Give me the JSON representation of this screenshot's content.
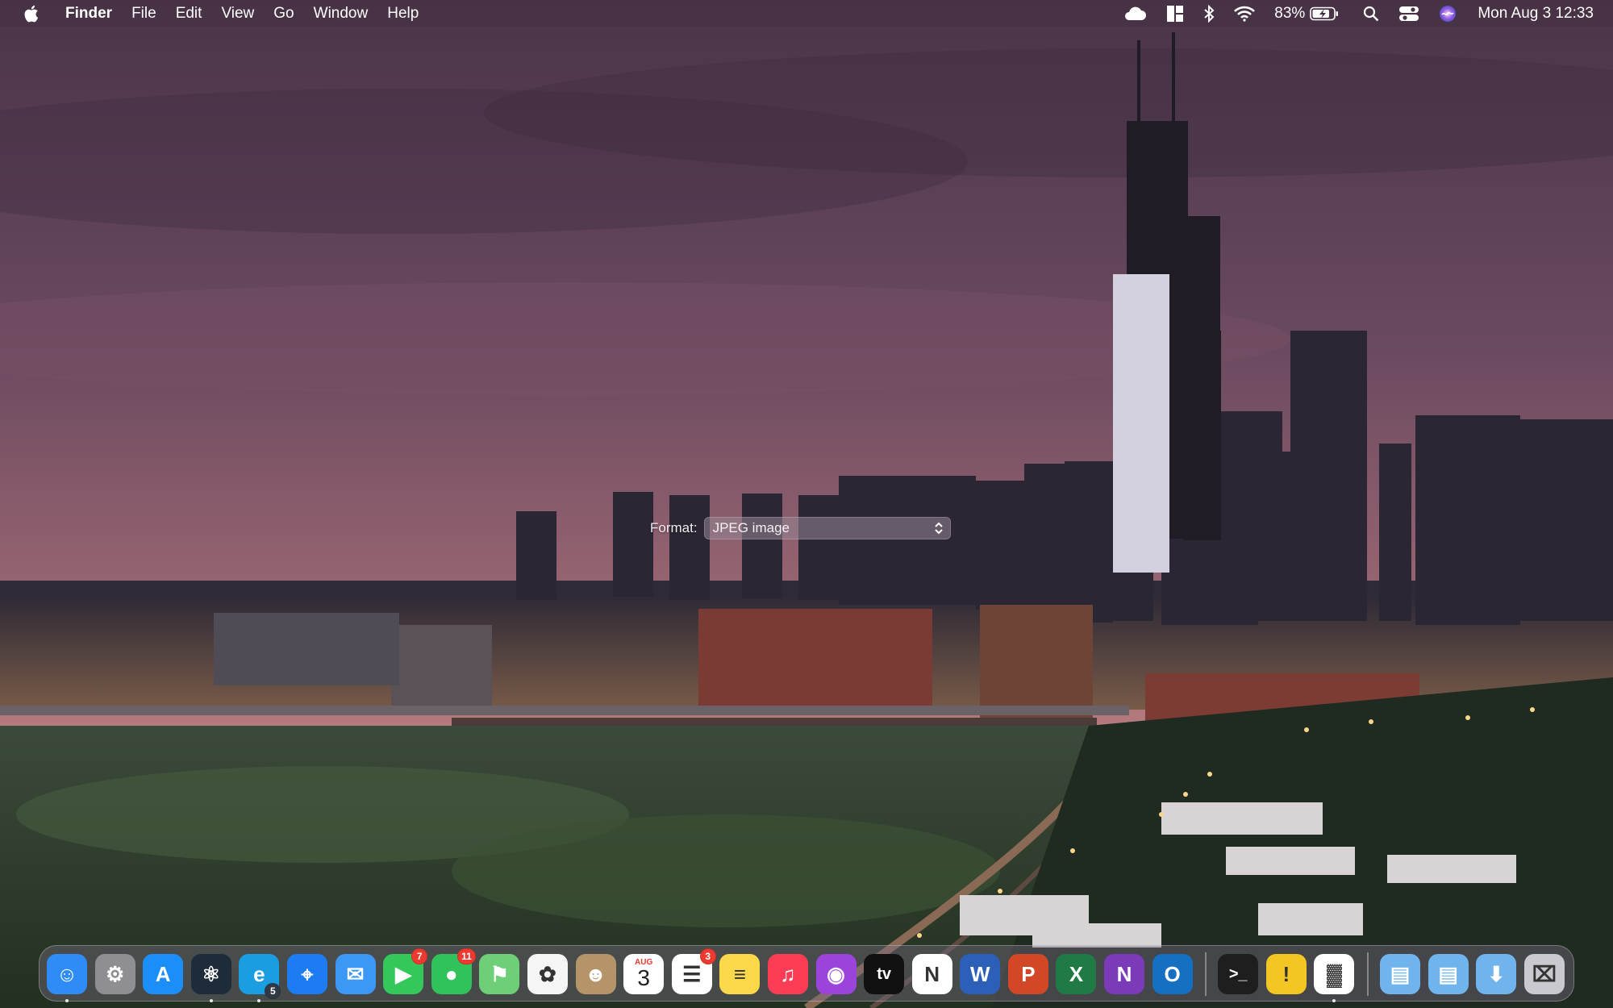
{
  "menubar": {
    "apple_icon": "apple-logo-icon",
    "app_name": "Finder",
    "menus": [
      "File",
      "Edit",
      "View",
      "Go",
      "Window",
      "Help"
    ],
    "status": {
      "battery_percent": "83%",
      "datetime": "Mon Aug 3  12:33"
    }
  },
  "format_control": {
    "label": "Format:",
    "value": "JPEG image"
  },
  "dock": {
    "apps": [
      {
        "name": "Finder",
        "icon": "finder-icon",
        "color": "#2f8bf5",
        "running": true
      },
      {
        "name": "System Preferences",
        "icon": "gear-icon",
        "color": "#8e8e93"
      },
      {
        "name": "App Store",
        "icon": "app-store-icon",
        "color": "#1c8ef9"
      },
      {
        "name": "Atom",
        "icon": "atom-icon",
        "color": "#1d2b3a",
        "running": true
      },
      {
        "name": "Microsoft Edge",
        "icon": "edge-icon",
        "color": "#1b9de2",
        "badge": "5",
        "running": true
      },
      {
        "name": "Safari",
        "icon": "compass-icon",
        "color": "#1e7cf2"
      },
      {
        "name": "Mail",
        "icon": "mail-icon",
        "color": "#3d97f5"
      },
      {
        "name": "FaceTime",
        "icon": "video-camera-icon",
        "color": "#34c759",
        "badge": "7"
      },
      {
        "name": "Messages",
        "icon": "chat-bubble-icon",
        "color": "#32c25a",
        "badge": "11"
      },
      {
        "name": "Maps",
        "icon": "map-icon",
        "color": "#6fcf78"
      },
      {
        "name": "Photos",
        "icon": "photos-flower-icon",
        "color": "#f5f5f5"
      },
      {
        "name": "Contacts",
        "icon": "contacts-icon",
        "color": "#b6946a"
      },
      {
        "name": "Calendar",
        "icon": "calendar-icon",
        "color": "#ffffff",
        "month": "AUG",
        "day": "3"
      },
      {
        "name": "Reminders",
        "icon": "reminders-list-icon",
        "color": "#ffffff",
        "badge": "3"
      },
      {
        "name": "Notes",
        "icon": "notes-icon",
        "color": "#fbd84a"
      },
      {
        "name": "Music",
        "icon": "music-note-icon",
        "color": "#fb3c55"
      },
      {
        "name": "Podcasts",
        "icon": "podcast-icon",
        "color": "#9b44db"
      },
      {
        "name": "TV",
        "icon": "apple-tv-icon",
        "color": "#111111",
        "label": "tv"
      },
      {
        "name": "News",
        "icon": "news-icon",
        "color": "#ffffff"
      },
      {
        "name": "Microsoft Word",
        "icon": "word-icon",
        "color": "#2b5fb8",
        "letter": "W"
      },
      {
        "name": "Microsoft PowerPoint",
        "icon": "powerpoint-icon",
        "color": "#d24726",
        "letter": "P"
      },
      {
        "name": "Microsoft Excel",
        "icon": "excel-icon",
        "color": "#1f7a45",
        "letter": "X"
      },
      {
        "name": "Microsoft OneNote",
        "icon": "onenote-icon",
        "color": "#7b3ab8",
        "letter": "N"
      },
      {
        "name": "Microsoft Outlook",
        "icon": "outlook-icon",
        "color": "#1570c4",
        "letter": "O"
      }
    ],
    "utilities": [
      {
        "name": "Terminal",
        "icon": "terminal-icon",
        "color": "#1e1e1e",
        "label": ">_"
      },
      {
        "name": "Console",
        "icon": "warning-triangle-icon",
        "color": "#f3c623"
      },
      {
        "name": "Numbers",
        "icon": "bar-chart-icon",
        "color": "#ffffff",
        "running": true
      }
    ],
    "folders": [
      {
        "name": "Applications",
        "icon": "applications-folder-icon",
        "color": "#6fb4ec"
      },
      {
        "name": "Documents",
        "icon": "documents-folder-icon",
        "color": "#6fb4ec"
      },
      {
        "name": "Downloads",
        "icon": "downloads-folder-icon",
        "color": "#6fb4ec"
      },
      {
        "name": "Trash",
        "icon": "trash-icon",
        "color": "#c9c9cf"
      }
    ]
  }
}
